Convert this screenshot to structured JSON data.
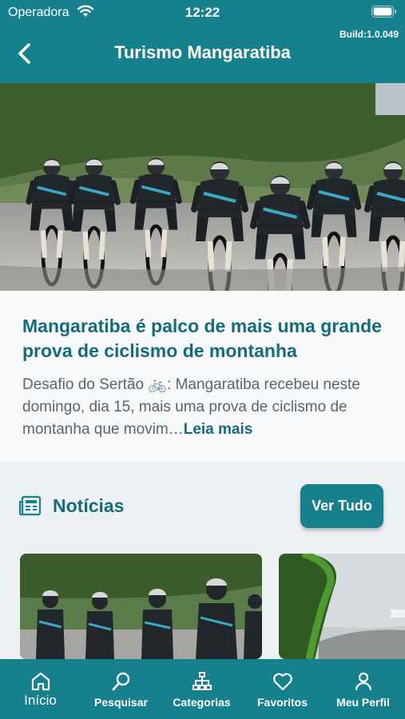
{
  "status_bar": {
    "carrier": "Operadora",
    "time": "12:22"
  },
  "header": {
    "build": "Build:1.0.049",
    "title": "Turismo Mangaratiba"
  },
  "featured": {
    "title": "Mangaratiba é palco de mais uma grande prova de ciclismo de montanha",
    "excerpt": "Desafio do Sertão 🚲: Mangaratiba recebeu neste domingo, dia 15, mais uma prova de ciclismo de montanha que movim…",
    "read_more": "Leia mais"
  },
  "news": {
    "title": "Notícias",
    "see_all_label": "Ver Tudo"
  },
  "tabbar": {
    "items": [
      {
        "label": "Início",
        "icon": "home-icon"
      },
      {
        "label": "Pesquisar",
        "icon": "search-icon"
      },
      {
        "label": "Categorias",
        "icon": "categories-icon"
      },
      {
        "label": "Favoritos",
        "icon": "heart-icon"
      },
      {
        "label": "Meu Perfil",
        "icon": "user-icon"
      }
    ],
    "active_index": 0
  },
  "colors": {
    "brand": "#16808c",
    "title_text": "#156b7c",
    "body_text": "#5a646b"
  }
}
